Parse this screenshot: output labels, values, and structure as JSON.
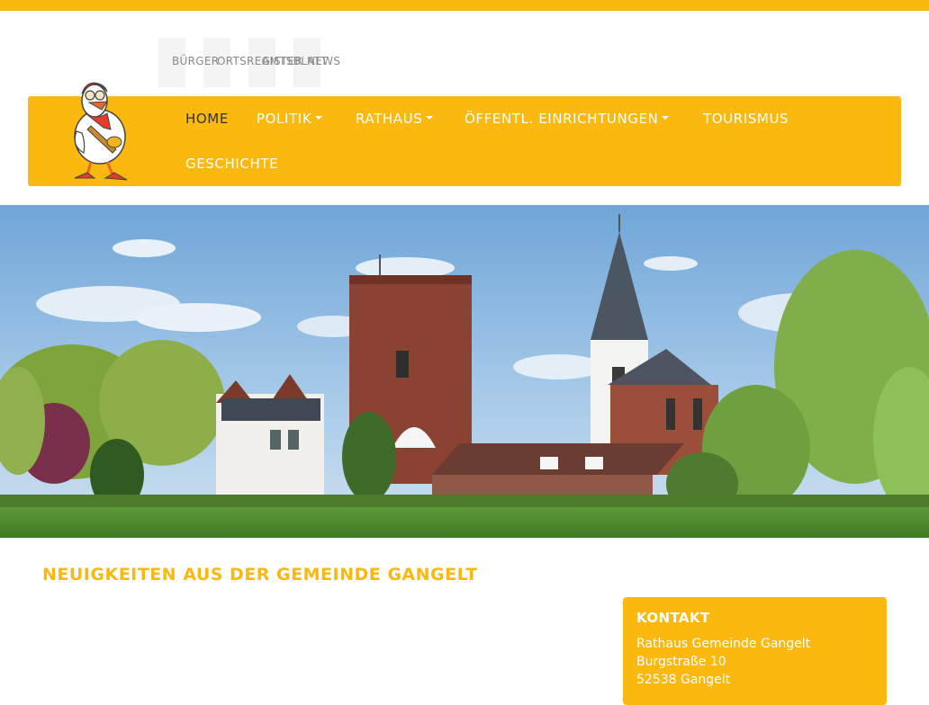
{
  "quicklinks": [
    "BÜRGER",
    "ORTSREGISTER",
    "AMTSBLATT",
    "NEWS"
  ],
  "nav": {
    "items": [
      "HOME",
      "POLITIK",
      "RATHAUS",
      "ÖFFENTL. EINRICHTUNGEN",
      "TOURISMUS",
      "GESCHICHTE"
    ],
    "active": "HOME"
  },
  "news": {
    "heading": "NEUIGKEITEN AUS DER GEMEINDE GANGELT"
  },
  "contact": {
    "title": "KONTAKT",
    "lines": [
      "Rathaus Gemeinde Gangelt",
      "Burgstraße 10",
      "52538 Gangelt"
    ]
  },
  "colors": {
    "accent": "#fbb80f",
    "active_nav": "#333333"
  },
  "icons": {
    "logo": "duck-mascot-icon",
    "dropdown": "caret-down-icon"
  }
}
